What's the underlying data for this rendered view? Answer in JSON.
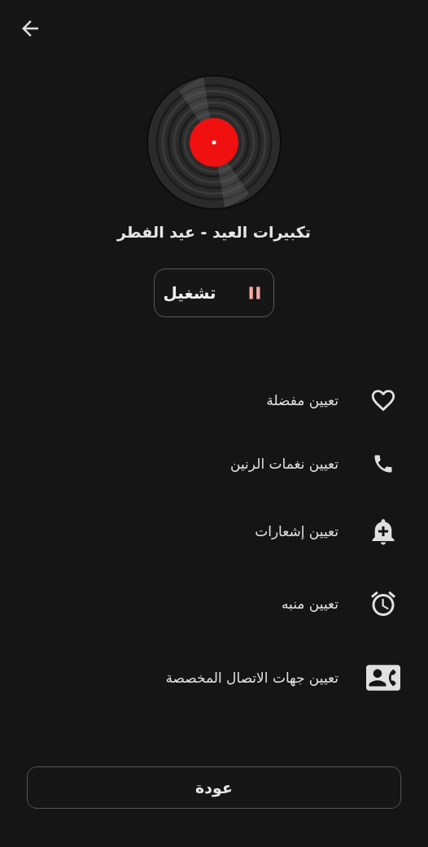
{
  "title": "تكبيرات العيد - عيد الفطر",
  "play_button": {
    "label": "تشغيل",
    "playing": true
  },
  "options": [
    {
      "kind": "favorite",
      "label": "تعيين مفضلة"
    },
    {
      "kind": "ringtone",
      "label": "تعيين نغمات الرنين"
    },
    {
      "kind": "notification",
      "label": "تعيين إشعارات"
    },
    {
      "kind": "alarm",
      "label": "تعيين منبه"
    },
    {
      "kind": "contacts",
      "label": "تعيين جهات الاتصال المخصصة"
    }
  ],
  "back_button": "عودة"
}
